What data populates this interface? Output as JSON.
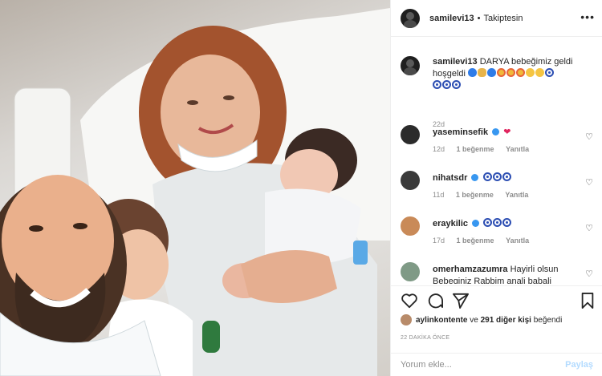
{
  "header": {
    "username": "samilevi13",
    "separator": "•",
    "follow_status": "Takiptesin",
    "more_icon": "more-dots-icon"
  },
  "caption": {
    "username": "samilevi13",
    "text": "DARYA bebeğimiz geldi hoşgeldi",
    "emojis": [
      "blue-heart",
      "praying-hands",
      "blue-heart",
      "star-struck",
      "star-struck",
      "star-struck",
      "kissing-face",
      "kissing-face",
      "nazar",
      "nazar",
      "nazar",
      "nazar"
    ],
    "time": "22d"
  },
  "comments": [
    {
      "username": "yaseminsefik",
      "verified": true,
      "text": "",
      "emojis": [
        "red-heart"
      ],
      "time": "12d",
      "likes": "1 beğenme",
      "reply": "Yanıtla",
      "avatar_color": "#2b2b2b"
    },
    {
      "username": "nihatsdr",
      "verified": true,
      "text": "",
      "emojis": [
        "nazar",
        "nazar",
        "nazar"
      ],
      "time": "11d",
      "likes": "1 beğenme",
      "reply": "Yanıtla",
      "avatar_color": "#3a3a3a"
    },
    {
      "username": "eraykilic",
      "verified": true,
      "text": "",
      "emojis": [
        "nazar",
        "nazar",
        "nazar"
      ],
      "time": "17d",
      "likes": "1 beğenme",
      "reply": "Yanıtla",
      "avatar_color": "#c98a58"
    },
    {
      "username": "omerhamzazumra",
      "verified": false,
      "text": "Hayirli olsun Bebeginiz Rabbim anali babali",
      "emojis": [],
      "time": "",
      "likes": "",
      "reply": "",
      "avatar_color": "#7f9a86"
    }
  ],
  "actions": {
    "like_icon": "heart-outline-icon",
    "comment_icon": "comment-icon",
    "share_icon": "paper-plane-icon",
    "save_icon": "bookmark-icon"
  },
  "likes": {
    "first_liker": "aylinkontente",
    "connector": "ve",
    "others": "291 diğer kişi",
    "suffix": "beğendi"
  },
  "post_time": "22 DAKİKA ÖNCE",
  "comment_input": {
    "placeholder": "Yorum ekle...",
    "submit_label": "Paylaş"
  },
  "colors": {
    "verified": "#3897f0",
    "text": "#262626",
    "muted": "#8e8e8e",
    "share_disabled": "#b3dbff",
    "divider": "#efefef"
  }
}
